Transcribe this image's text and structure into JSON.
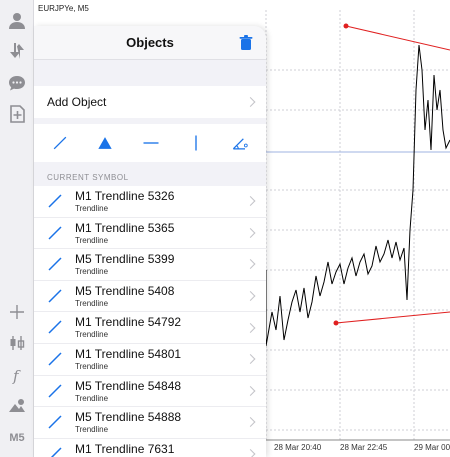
{
  "chart": {
    "symbol": "EURJPYe, M5",
    "time_labels": [
      "28 Mar 20:40",
      "28 Mar 22:45",
      "29 Mar 00"
    ]
  },
  "toolbar": {
    "timeframe": "M5",
    "icons": [
      "account-icon",
      "trade-icon",
      "chat-icon",
      "new-order-icon",
      "crosshair-icon",
      "chart-type-icon",
      "indicators-icon",
      "objects-icon"
    ]
  },
  "panel": {
    "title": "Objects",
    "add_object": "Add Object",
    "section": "CURRENT SYMBOL",
    "items": [
      {
        "title": "M1 Trendline 5326",
        "sub": "Trendline"
      },
      {
        "title": "M1 Trendline 5365",
        "sub": "Trendline"
      },
      {
        "title": "M5 Trendline 5399",
        "sub": "Trendline"
      },
      {
        "title": "M5 Trendline 5408",
        "sub": "Trendline"
      },
      {
        "title": "M1 Trendline 54792",
        "sub": "Trendline"
      },
      {
        "title": "M1 Trendline 54801",
        "sub": "Trendline"
      },
      {
        "title": "M5 Trendline 54848",
        "sub": "Trendline"
      },
      {
        "title": "M5 Trendline 54888",
        "sub": "Trendline"
      },
      {
        "title": "M1 Trendline 7631",
        "sub": ""
      }
    ]
  },
  "colors": {
    "accent": "#1a73e8",
    "trendline": "#e02020",
    "price": "#000000",
    "level": "#9fb3e0"
  }
}
